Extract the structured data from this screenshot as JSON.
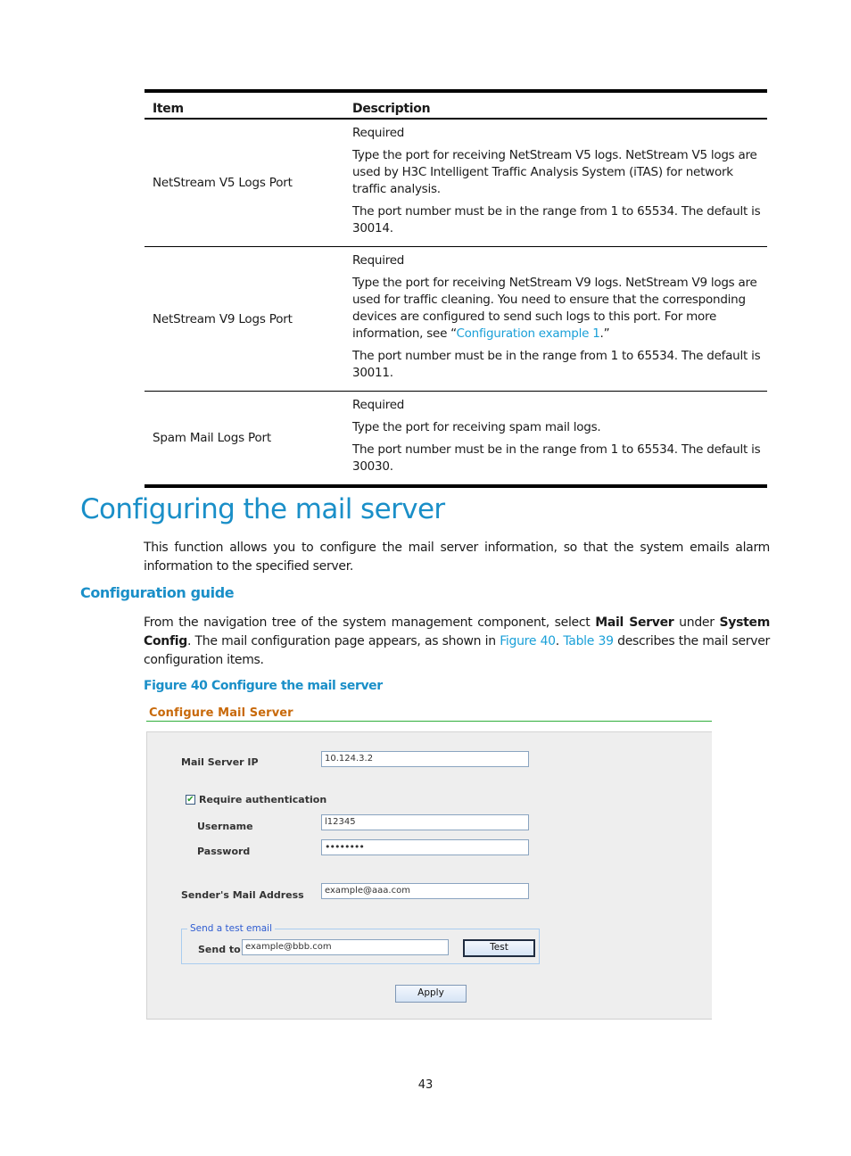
{
  "table": {
    "headers": {
      "item": "Item",
      "description": "Description"
    },
    "rows": [
      {
        "item": "NetStream V5 Logs Port",
        "desc": [
          "Required",
          "Type the port for receiving NetStream V5 logs. NetStream V5 logs are used by H3C Intelligent Traffic Analysis System (iTAS) for network traffic analysis.",
          "The port number must be in the range from 1 to 65534. The default is 30014."
        ]
      },
      {
        "item": "NetStream V9 Logs Port",
        "desc": [
          "Required",
          "The port number must be in the range from 1 to 65534. The default is 30011."
        ],
        "desc_link_para": {
          "before": "Type the port for receiving NetStream V9 logs. NetStream V9 logs are used for traffic cleaning. You need to ensure that the corresponding devices are configured to send such logs to this port. For more information, see “",
          "link": "Configuration example 1",
          "after": ".”"
        }
      },
      {
        "item": "Spam Mail Logs Port",
        "desc": [
          "Required",
          "Type the port for receiving spam mail logs.",
          "The port number must be in the range from 1 to 65534. The default is 30030."
        ]
      }
    ]
  },
  "section": {
    "title": "Configuring the mail server",
    "intro": "This function allows you to configure the mail server information, so that the system emails alarm information to the specified server.",
    "subheading": "Configuration guide",
    "guide": {
      "t1": "From the navigation tree of the system management component, select ",
      "b1": "Mail Server",
      "t2": " under ",
      "b2": "System Config",
      "t3": ". The mail configuration page appears, as shown in ",
      "link1": "Figure 40",
      "t4": ". ",
      "link2": "Table 39",
      "t5": " describes the mail server configuration items."
    },
    "figure_caption": "Figure 40 Configure the mail server"
  },
  "form": {
    "title": "Configure Mail Server",
    "mail_server_ip_label": "Mail Server IP",
    "mail_server_ip_value": "10.124.3.2",
    "require_auth_label": "Require authentication",
    "require_auth_checked": true,
    "username_label": "Username",
    "username_value": "l12345",
    "password_label": "Password",
    "password_value": "••••••••",
    "sender_label": "Sender's Mail Address",
    "sender_value": "example@aaa.com",
    "test_group_legend": "Send a test email",
    "send_to_label": "Send to:",
    "send_to_value": "example@bbb.com",
    "test_button": "Test",
    "apply_button": "Apply",
    "check_glyph": "✔"
  },
  "page_number": "43"
}
